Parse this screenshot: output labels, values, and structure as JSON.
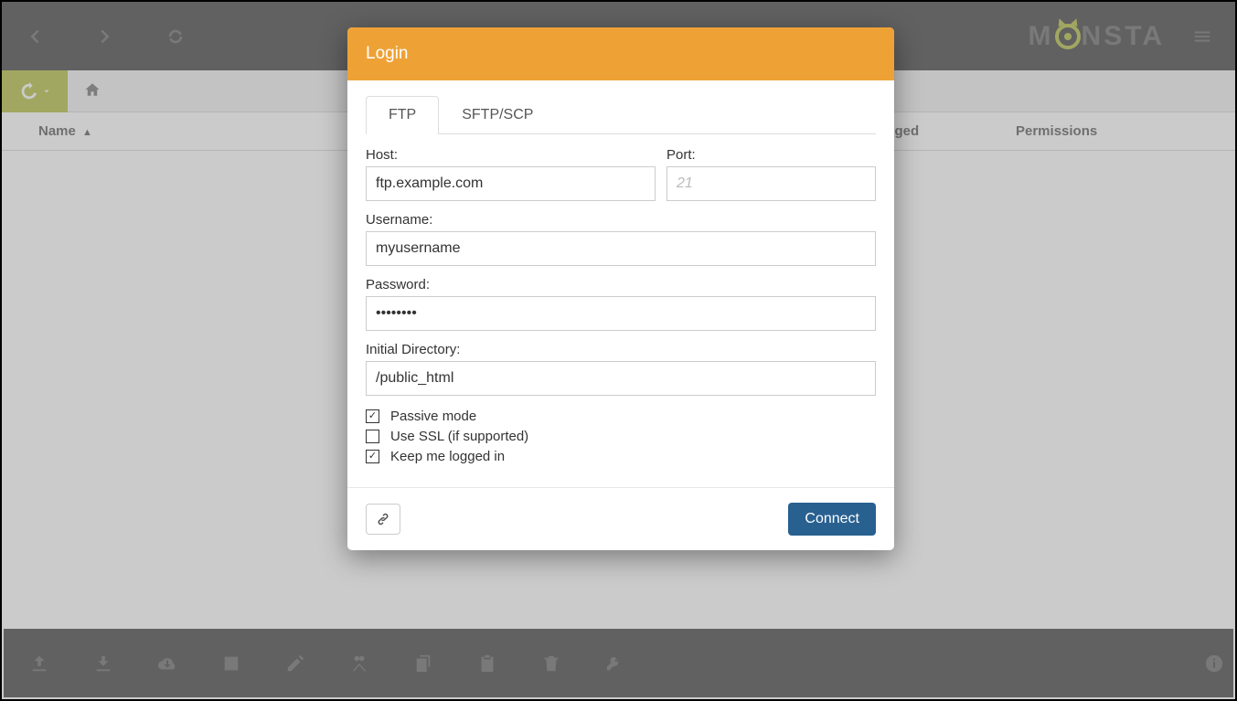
{
  "brand": {
    "name": "MONSTA",
    "pre": "M",
    "post": "NSTA"
  },
  "table": {
    "col_name": "Name",
    "col_changed": "Changed",
    "col_permissions": "Permissions"
  },
  "modal": {
    "title": "Login",
    "tabs": {
      "ftp": "FTP",
      "sftp": "SFTP/SCP"
    },
    "labels": {
      "host": "Host:",
      "port": "Port:",
      "username": "Username:",
      "password": "Password:",
      "initial_dir": "Initial Directory:"
    },
    "values": {
      "host": "ftp.example.com",
      "port": "",
      "port_placeholder": "21",
      "username": "myusername",
      "password": "••••••••",
      "initial_dir": "/public_html"
    },
    "checks": {
      "passive": {
        "label": "Passive mode",
        "checked": true
      },
      "ssl": {
        "label": "Use SSL (if supported)",
        "checked": false
      },
      "remember": {
        "label": "Keep me logged in",
        "checked": true
      }
    },
    "connect": "Connect"
  }
}
